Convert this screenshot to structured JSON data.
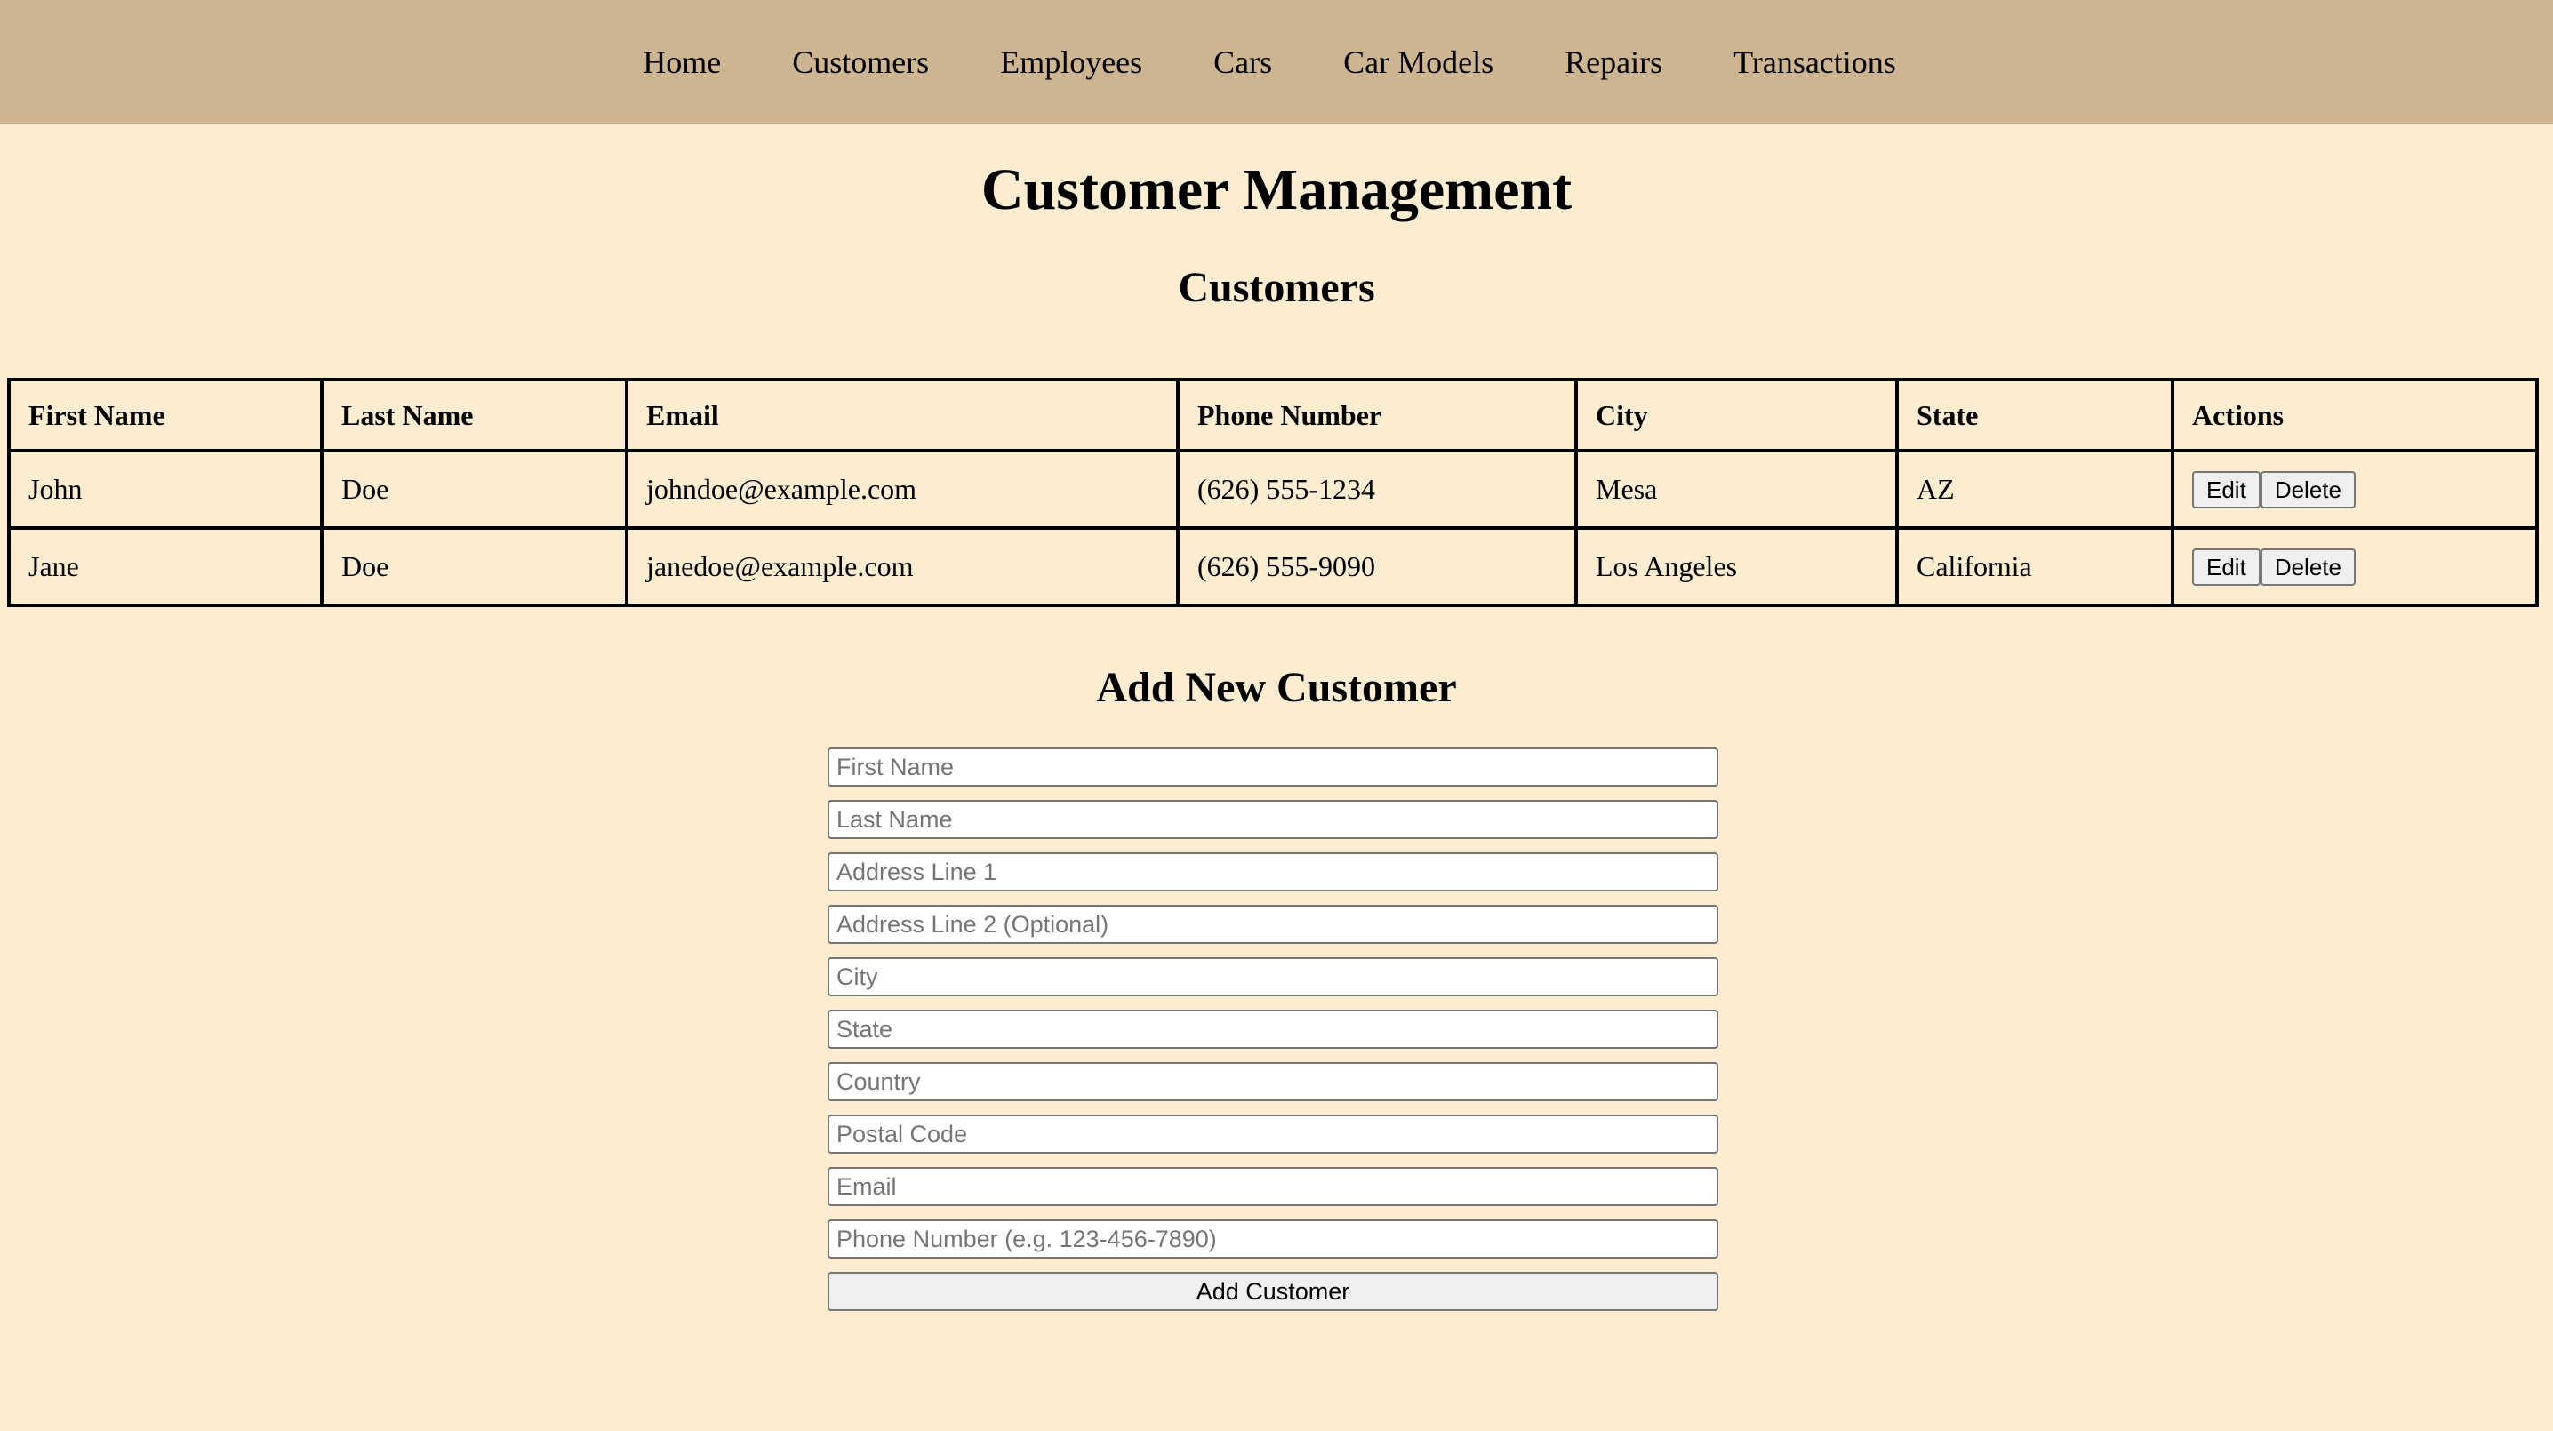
{
  "nav": {
    "items": [
      "Home",
      "Customers",
      "Employees",
      "Cars",
      "Car Models",
      "Repairs",
      "Transactions"
    ]
  },
  "page_title": "Customer Management",
  "customers_section": {
    "title": "Customers",
    "columns": [
      "First Name",
      "Last Name",
      "Email",
      "Phone Number",
      "City",
      "State",
      "Actions"
    ],
    "rows": [
      {
        "first": "John",
        "last": "Doe",
        "email": "johndoe@example.com",
        "phone": "(626) 555-1234",
        "city": "Mesa",
        "state": "AZ"
      },
      {
        "first": "Jane",
        "last": "Doe",
        "email": "janedoe@example.com",
        "phone": "(626) 555-9090",
        "city": "Los Angeles",
        "state": "California"
      }
    ],
    "edit_label": "Edit",
    "delete_label": "Delete"
  },
  "add_form": {
    "title": "Add New Customer",
    "placeholders": {
      "first_name": "First Name",
      "last_name": "Last Name",
      "address1": "Address Line 1",
      "address2": "Address Line 2 (Optional)",
      "city": "City",
      "state": "State",
      "country": "Country",
      "postal_code": "Postal Code",
      "email": "Email",
      "phone": "Phone Number (e.g. 123-456-7890)"
    },
    "submit_label": "Add Customer"
  },
  "colors": {
    "background": "#fcecd0",
    "navbar": "#cdb592"
  }
}
